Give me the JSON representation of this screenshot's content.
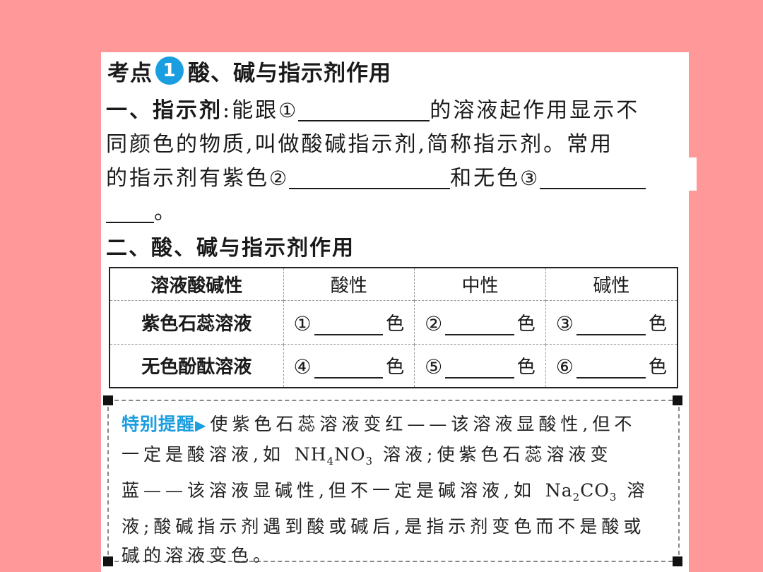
{
  "heading": {
    "prefix": "考点",
    "badge": "1",
    "title": "酸、碱与指示剂作用"
  },
  "section1": {
    "label": "一、指示剂",
    "colon": ":",
    "line1_a": "能跟",
    "blank1_num": "①",
    "line1_b": "的溶液起作用显示不",
    "line2": "同颜色的物质,叫做酸碱指示剂,简称指示剂。常用",
    "line3_a": "的指示剂有紫色",
    "blank2_num": "②",
    "line3_b": "和无色",
    "blank3_num": "③",
    "line4_end": "。"
  },
  "section2": {
    "title": "二、酸、碱与指示剂作用"
  },
  "table": {
    "headers": [
      "溶液酸碱性",
      "酸性",
      "中性",
      "碱性"
    ],
    "rows": [
      {
        "label": "紫色石蕊溶液",
        "cells": [
          {
            "num": "①",
            "suffix": "色"
          },
          {
            "num": "②",
            "suffix": "色"
          },
          {
            "num": "③",
            "suffix": "色"
          }
        ]
      },
      {
        "label": "无色酚酞溶液",
        "cells": [
          {
            "num": "④",
            "suffix": "色"
          },
          {
            "num": "⑤",
            "suffix": "色"
          },
          {
            "num": "⑥",
            "suffix": "色"
          }
        ]
      }
    ]
  },
  "note": {
    "tag": "特别提醒",
    "t1": "使紫色石蕊溶液变红——该溶液显酸性,但不",
    "t2a": "一定是酸溶液,如",
    "chem1_a": "NH",
    "chem1_s1": "4",
    "chem1_b": "NO",
    "chem1_s2": "3",
    "t2b": "溶液;使紫色石蕊溶液变",
    "t3a": "蓝——该溶液显碱性,但不一定是碱溶液,如",
    "chem2_a": "Na",
    "chem2_s1": "2",
    "chem2_b": "CO",
    "chem2_s2": "3",
    "t3b": "溶",
    "t4": "液;酸碱指示剂遇到酸或碱后,是指示剂变色而不是酸或",
    "t5": "碱的溶液变色。"
  },
  "colors": {
    "background": "#ff9999",
    "accent": "#1a9ee0"
  }
}
